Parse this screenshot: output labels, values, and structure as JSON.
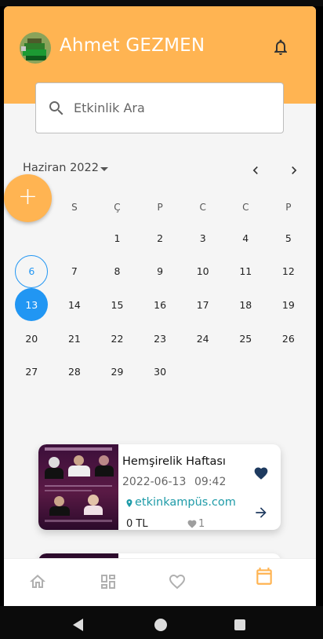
{
  "header": {
    "username": "Ahmet GEZMEN",
    "bell_icon": "bell-icon",
    "background": "#ffb452"
  },
  "search": {
    "placeholder": "Etkinlik Ara",
    "icon": "search-icon"
  },
  "calendar": {
    "month_label": "Haziran 2022",
    "weekdays": [
      "P",
      "S",
      "Ç",
      "P",
      "C",
      "C",
      "P"
    ],
    "weeks": [
      [
        "",
        "",
        "1",
        "2",
        "3",
        "4",
        "5"
      ],
      [
        "6",
        "7",
        "8",
        "9",
        "10",
        "11",
        "12"
      ],
      [
        "13",
        "14",
        "15",
        "16",
        "17",
        "18",
        "19"
      ],
      [
        "20",
        "21",
        "22",
        "23",
        "24",
        "25",
        "26"
      ],
      [
        "27",
        "28",
        "29",
        "30",
        "",
        "",
        ""
      ]
    ],
    "today": "6",
    "selected": "13",
    "accent": "#2196f3"
  },
  "fab": {
    "label": "+"
  },
  "events": [
    {
      "title": "Hemşirelik Haftası",
      "date": "2022-06-13",
      "time": "09:42",
      "site": "etkinkampüs.com",
      "price": "0 TL",
      "likes": "1",
      "site_color": "#1e9ba8"
    }
  ],
  "bottom_nav": {
    "items": [
      "home-icon",
      "dashboard-icon",
      "favorite-icon",
      "calendar-icon"
    ],
    "active": "calendar-icon",
    "active_color": "#ffb452"
  }
}
